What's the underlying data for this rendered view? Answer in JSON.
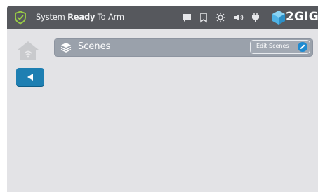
{
  "status_bar": {
    "status_prefix": "System",
    "status_emphasis": "Ready",
    "status_suffix": "To Arm",
    "icons": [
      "message-icon",
      "bookmark-icon",
      "brightness-icon",
      "volume-icon",
      "power-plug-icon"
    ],
    "brand": "2GIG"
  },
  "nav": {
    "home_icon": "home-wifi-icon",
    "back_icon": "back-arrow-icon"
  },
  "header": {
    "icon": "layers-icon",
    "title": "Scenes",
    "edit_button_label": "Edit Scenes",
    "edit_icon": "pencil-icon"
  },
  "colors": {
    "status_bar": "#56585d",
    "background": "#e3e3e6",
    "header_bar": "#9aa1ab",
    "accent_blue": "#1e7fb2",
    "shield_green": "#9bcf45"
  }
}
